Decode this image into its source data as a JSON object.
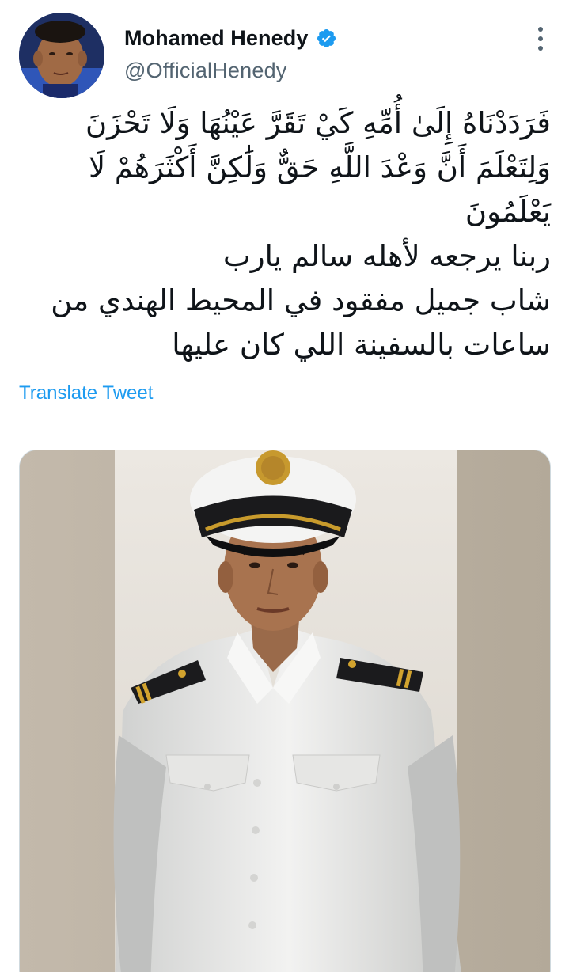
{
  "tweet": {
    "author": {
      "display_name": "Mohamed Henedy",
      "handle": "@OfficialHenedy",
      "verified": true,
      "avatar_icon": "profile-photo"
    },
    "more_icon": "more-vertical-icon",
    "text_lines": [
      "فَرَدَدْنَاهُ إِلَىٰ أُمِّهِ كَيْ تَقَرَّ عَيْنُهَا وَلَا تَحْزَنَ",
      "وَلِتَعْلَمَ أَنَّ وَعْدَ اللَّهِ حَقٌّ وَلَٰكِنَّ أَكْثَرَهُمْ لَا",
      "يَعْلَمُونَ",
      "ربنا يرجعه لأهله سالم يارب",
      "شاب جميل مفقود في المحيط الهندي من",
      "ساعات بالسفينة اللي كان عليها"
    ],
    "translate_label": "Translate Tweet",
    "media": {
      "type": "photo",
      "description_icon": "photo-young-officer-in-white-uniform"
    },
    "colors": {
      "link": "#1d9bf0",
      "verified": "#1d9bf0",
      "secondary_text": "#536471",
      "primary_text": "#0f1419"
    }
  }
}
